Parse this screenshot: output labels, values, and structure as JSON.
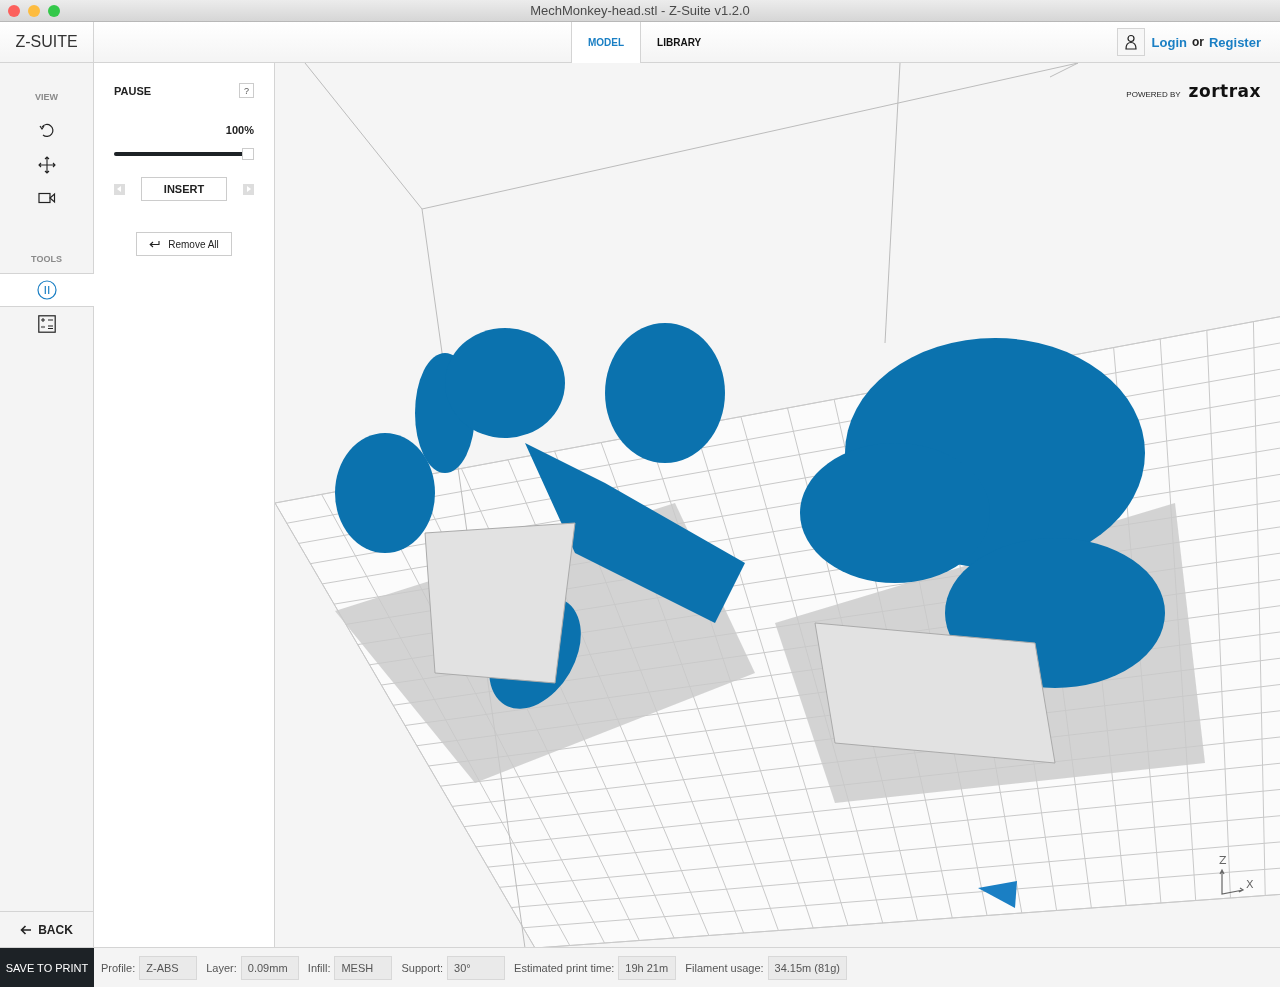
{
  "window": {
    "title": "MechMonkey-head.stl - Z-Suite v1.2.0"
  },
  "header": {
    "logo": "Z-SUITE",
    "tabs": [
      {
        "label": "MODEL",
        "selected": true
      },
      {
        "label": "LIBRARY",
        "selected": false
      }
    ],
    "account": {
      "login": "Login",
      "or": "or",
      "register": "Register"
    }
  },
  "sidebar": {
    "view_label": "VIEW",
    "tools_label": "TOOLS",
    "tools": [
      {
        "kind": "pause",
        "selected": true
      },
      {
        "kind": "calculator",
        "selected": false
      }
    ],
    "back": "BACK"
  },
  "panel": {
    "title": "PAUSE",
    "help": "?",
    "reading": "100%",
    "level": 1.0,
    "insert": "INSERT",
    "remove_all": "Remove All"
  },
  "viewport": {
    "powered_by": "POWERED BY",
    "brand": "zortrax",
    "axes": [
      "Z",
      "X"
    ]
  },
  "footer": {
    "save": "SAVE TO PRINT",
    "fields": [
      {
        "label": "Profile:",
        "value": "Z-ABS"
      },
      {
        "label": "Layer:",
        "value": "0.09mm"
      },
      {
        "label": "Infill:",
        "value": "MESH"
      },
      {
        "label": "Support:",
        "value": "30°"
      },
      {
        "label": "Estimated print time:",
        "value": "19h 21m"
      },
      {
        "label": "Filament usage:",
        "value": "34.15m (81g)"
      }
    ]
  }
}
